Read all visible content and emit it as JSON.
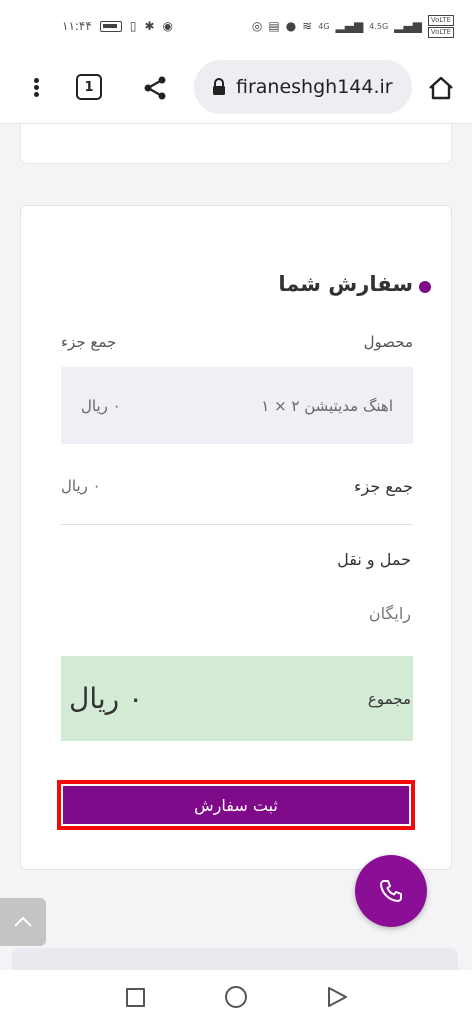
{
  "status_bar": {
    "time": "۱۱:۴۴",
    "network_a": "4G",
    "network_b": "4.5G",
    "volte_1": "VoLTE",
    "volte_2": "VoLTE"
  },
  "browser": {
    "url": "firaneshgh144.ir",
    "tab_count": "1"
  },
  "order": {
    "title": "سفارش شما",
    "col_product": "محصول",
    "col_subtotal": "جمع جزء",
    "items": [
      {
        "name": "اهنگ مدیتیشن ۲  × ۱",
        "price": "۰ ریال"
      }
    ],
    "subtotal_label": "جمع جزء",
    "subtotal_value": "۰ ریال",
    "shipping_label": "حمل و نقل",
    "shipping_value": "رایگان",
    "total_label": "مجموع",
    "total_value": "۰ ریال",
    "submit_label": "ثبت سفارش"
  },
  "colors": {
    "brand": "#7e0a8a",
    "highlight_border": "#f20a0a",
    "total_bg": "#d3ebd5"
  }
}
